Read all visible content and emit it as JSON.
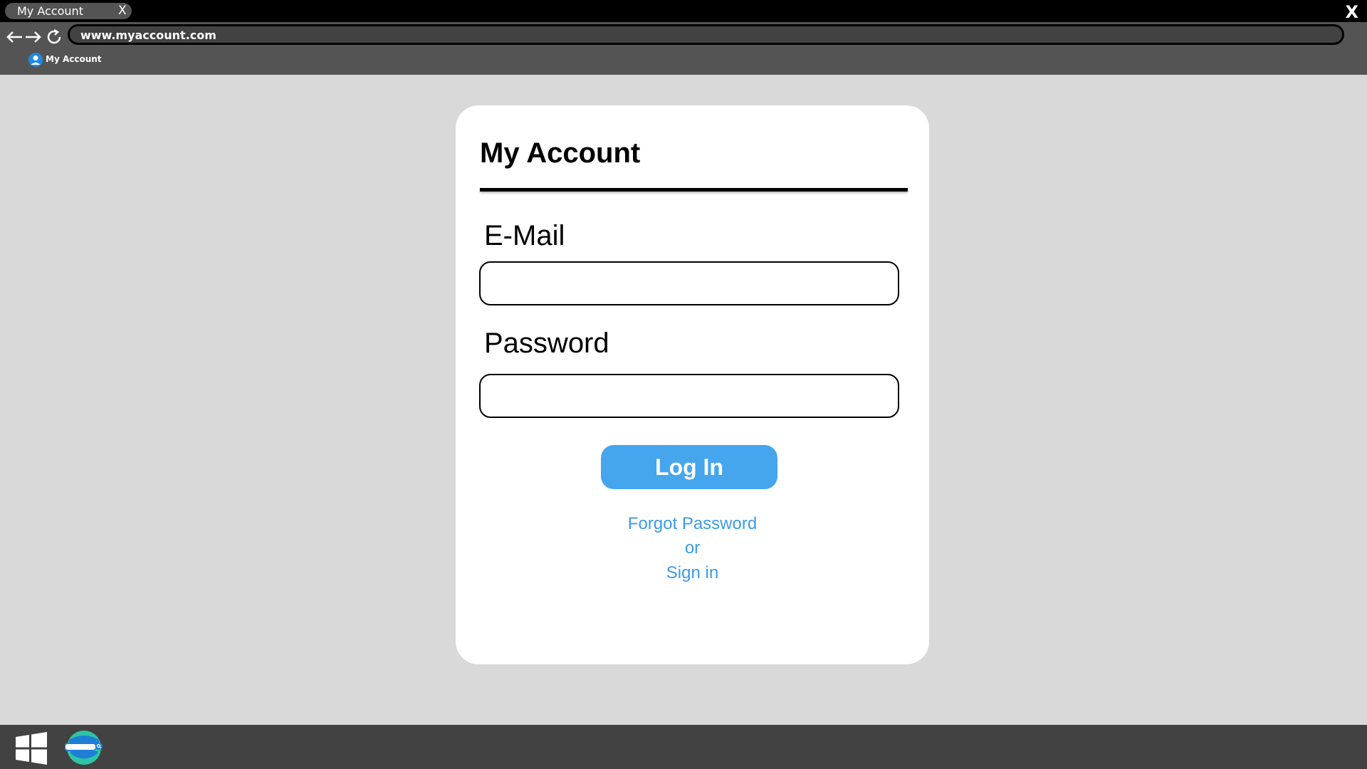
{
  "browser": {
    "tab_title": "My Account",
    "tab_close_label": "X",
    "window_close_label": "X",
    "url": "www.myaccount.com",
    "bookmark_label": "My Account"
  },
  "login_card": {
    "title": "My Account",
    "email_label": "E-Mail",
    "email_value": "",
    "password_label": "Password",
    "password_value": "",
    "login_button_label": "Log In",
    "forgot_password_label": "Forgot Password",
    "or_label": "or",
    "sign_in_label": "Sign in"
  },
  "colors": {
    "accent": "#45a6ee",
    "link": "#3a9be6",
    "page_background": "#d9d9d9",
    "toolbar": "#545454",
    "taskbar": "#424242"
  },
  "icons": {
    "back": "arrow-left-icon",
    "forward": "arrow-right-icon",
    "reload": "reload-icon",
    "bookmark": "user-icon",
    "start": "windows-logo-icon",
    "browser": "browser-app-icon"
  }
}
